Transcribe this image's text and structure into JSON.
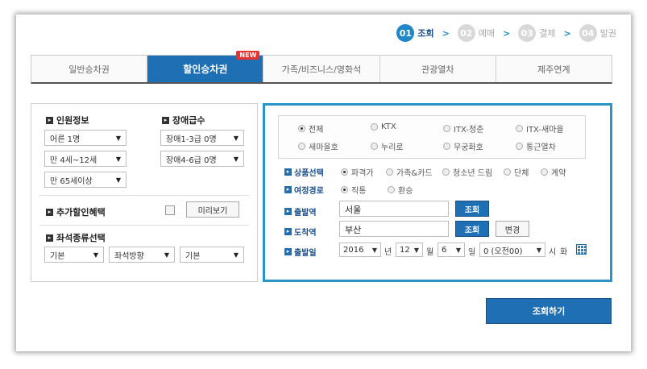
{
  "steps": [
    {
      "num": "01",
      "label": "조회",
      "active": true
    },
    {
      "num": "02",
      "label": "예매",
      "active": false
    },
    {
      "num": "03",
      "label": "결제",
      "active": false
    },
    {
      "num": "04",
      "label": "발권",
      "active": false
    }
  ],
  "step_arrow": ">",
  "tabs": [
    {
      "label": "일반승차권"
    },
    {
      "label": "할인승차권",
      "badge": "NEW"
    },
    {
      "label": "가족/비즈니스/영화석"
    },
    {
      "label": "관광열차"
    },
    {
      "label": "제주연계"
    }
  ],
  "passengers": {
    "title": "인원정보",
    "adult": "어른 1명",
    "child": "만 4세~12세",
    "senior": "만 65세이상"
  },
  "disability": {
    "title": "장애급수",
    "grade13": "장애1-3급 0명",
    "grade46": "장애4-6급 0명"
  },
  "discount": {
    "title": "추가할인혜택",
    "preview": "미리보기"
  },
  "seat": {
    "title": "좌석종류선택",
    "opt1": "기본",
    "opt2": "좌석방향",
    "opt3": "기본"
  },
  "train_types": [
    "전체",
    "KTX",
    "ITX-청춘",
    "ITX-새마을",
    "새마을호",
    "누리로",
    "무궁화호",
    "통근열차"
  ],
  "product": {
    "title": "상품선택",
    "options": [
      "파격가",
      "가족&카드",
      "청소년 드림",
      "단체",
      "계약"
    ]
  },
  "route": {
    "title": "여정경로",
    "options": [
      "직통",
      "환승"
    ]
  },
  "departure": {
    "title": "출발역",
    "value": "서울",
    "btn": "조회"
  },
  "arrival": {
    "title": "도착역",
    "value": "부산",
    "btn": "조회",
    "swap": "변경"
  },
  "date": {
    "title": "출발일",
    "year": "2016",
    "year_unit": "년",
    "month": "12",
    "month_unit": "월",
    "day": "6",
    "day_unit": "일",
    "time": "0 (오전00)",
    "time_unit": "시",
    "weekday": "화"
  },
  "search_button": "조회하기",
  "colors": {
    "accent": "#1f6fb5",
    "border_highlight": "#2a94c6",
    "badge": "#e8322f"
  }
}
